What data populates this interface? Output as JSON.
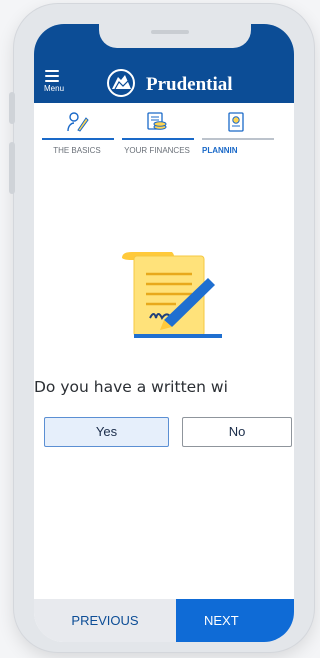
{
  "header": {
    "menu_label": "Menu",
    "brand_name": "Prudential",
    "background_color": "#0c4d96"
  },
  "tabs": [
    {
      "label": "THE BASICS",
      "icon": "pen-person-icon",
      "state": "complete"
    },
    {
      "label": "YOUR FINANCES",
      "icon": "money-stack-icon",
      "state": "complete"
    },
    {
      "label": "PLANNIN",
      "icon": "planning-document-icon",
      "state": "active"
    }
  ],
  "question": {
    "text": "Do you have a written wi",
    "illustration": "signed-scroll-icon"
  },
  "answers": {
    "yes_label": "Yes",
    "no_label": "No",
    "selected": "Yes"
  },
  "footer": {
    "previous_label": "PREVIOUS",
    "next_label": "NEXT",
    "next_color": "#0f6bd6"
  }
}
